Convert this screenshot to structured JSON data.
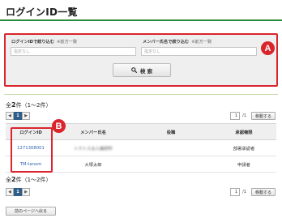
{
  "page": {
    "title": "ログインID一覧"
  },
  "search": {
    "login_id_label": "ログインIDで絞り込む",
    "login_id_note": "※前方一致",
    "login_id_placeholder": "指定なし",
    "member_name_label": "メンバー氏名で絞り込む",
    "member_name_note": "※前方一致",
    "member_name_placeholder": "指定なし",
    "button_label": "検 索"
  },
  "annotations": {
    "a": "A",
    "b": "B"
  },
  "summary": {
    "count": "2",
    "unit": "件",
    "range": "（1〜2件）"
  },
  "pager": {
    "prev": "◀",
    "current": "1",
    "next": "▶",
    "page_value": "1",
    "total": "/1",
    "move_label": "移動する"
  },
  "table": {
    "headers": [
      "ログインID",
      "メンバー氏名",
      "役職",
      "承認権限"
    ],
    "rows": [
      {
        "login_id": "1271308001",
        "member_name": "トクトス太人編研所",
        "role": "",
        "authority": "部署承認者"
      },
      {
        "login_id": "TM-tanom",
        "member_name": "大塚太郎",
        "role": "",
        "authority": "申請者"
      }
    ]
  },
  "back_button": "前のページへ戻る",
  "colors": {
    "accent_green": "#2e8b3e",
    "highlight_red": "#d9252c",
    "link_blue": "#2f62b0"
  }
}
